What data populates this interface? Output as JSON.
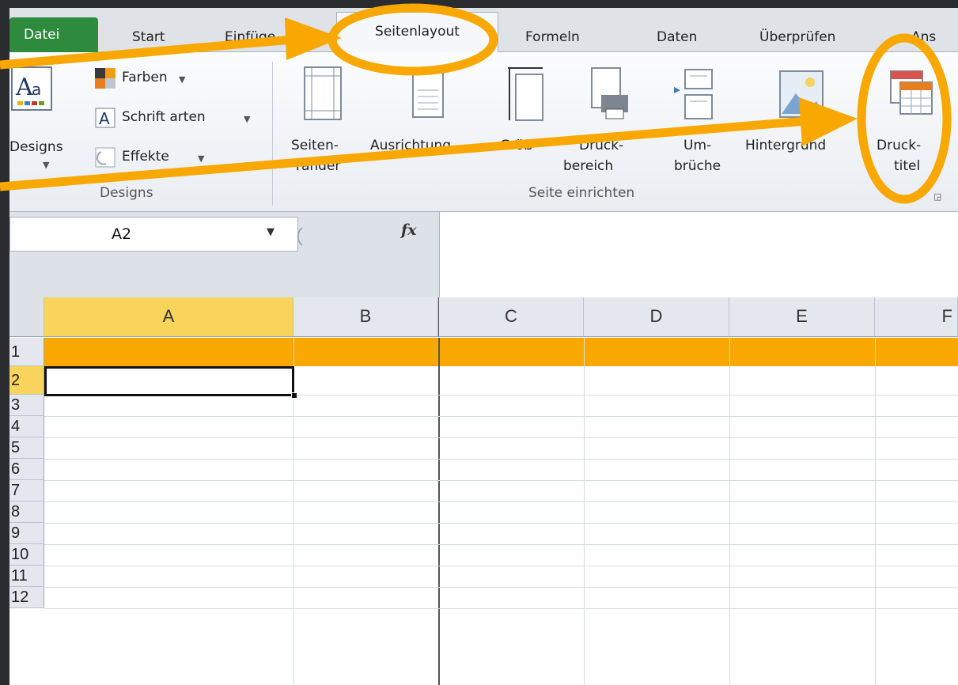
{
  "tabs": {
    "file": "Datei",
    "start": "Start",
    "insert": "Einfüge",
    "pagelayout": "Seitenlayout",
    "formulas": "Formeln",
    "data": "Daten",
    "review": "Überprüfen",
    "view": "Ans"
  },
  "ribbon": {
    "designs_button": "Designs",
    "farben": "Farben",
    "schriftarten": "Schrift arten",
    "effekte": "Effekte",
    "group_designs": "Designs",
    "seitenraender_1": "Seiten-",
    "seitenraender_2": "ränder",
    "ausrichtung": "Ausrichtung",
    "groesse": "Größ",
    "druckbereich_1": "Druck-",
    "druckbereich_2": "bereich",
    "umbrueche_1": "Um-",
    "umbrueche_2": "brüche",
    "hintergrund": "Hintergrund",
    "drucktitel_1": "Druck-",
    "drucktitel_2": "titel",
    "group_seite": "Seite einrichten"
  },
  "formula_bar": {
    "namebox": "A2",
    "fx": "fx"
  },
  "grid": {
    "columns": [
      "A",
      "B",
      "C",
      "D",
      "E",
      "F"
    ],
    "rows": [
      "1",
      "2",
      "3",
      "4",
      "5",
      "6",
      "7",
      "8",
      "9",
      "10",
      "11",
      "12"
    ],
    "selected_cell": "A2"
  },
  "colors": {
    "annotation": "#f8a800",
    "file_tab": "#2e8b3e",
    "header_highlight": "#f9d45c"
  }
}
